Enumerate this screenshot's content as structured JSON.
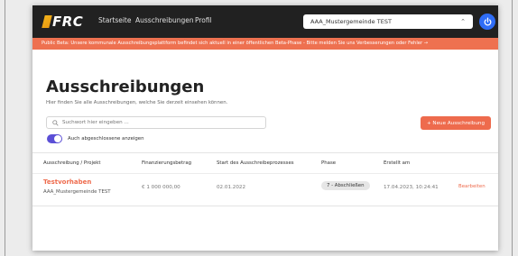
{
  "app": {
    "logo_text": "FRC"
  },
  "nav": {
    "items": [
      "Startseite",
      "Ausschreibungen",
      "Profil"
    ]
  },
  "org_select": {
    "value": "AAA_Mustergemeinde TEST"
  },
  "beta_banner": {
    "text": "Public Beta: Unsere kommunale Ausschreibungsplattform befindet sich aktuell in einer öffentlichen Beta-Phase - Bitte melden Sie uns Verbesserungen oder Fehler →"
  },
  "page": {
    "title": "Ausschreibungen",
    "subtitle": "Hier finden Sie alle Ausschreibungen, welche Sie derzeit einsehen können."
  },
  "search": {
    "placeholder": "Suchwort hier eingeben ..."
  },
  "new_button": {
    "label": "+  Neue Ausschreibung"
  },
  "toggle": {
    "label": "Auch abgeschlossene anzeigen",
    "checked": true
  },
  "table": {
    "headers": [
      "Ausschreibung / Projekt",
      "Finanzierungsbetrag",
      "Start des Ausschreibeprozesses",
      "Phase",
      "Erstellt am"
    ],
    "rows": [
      {
        "project": "Testvorhaben",
        "organization": "AAA_Mustergemeinde TEST",
        "amount": "€ 1 000 000,00",
        "start": "02.01.2022",
        "phase": "7 - Abschließen",
        "created": "17.04.2023, 10:24:41",
        "action": "Bearbeiten"
      }
    ]
  },
  "colors": {
    "accent": "#ee6b4d",
    "topbar": "#212121",
    "toggle": "#5b4fd6",
    "power": "#2f6df6"
  }
}
